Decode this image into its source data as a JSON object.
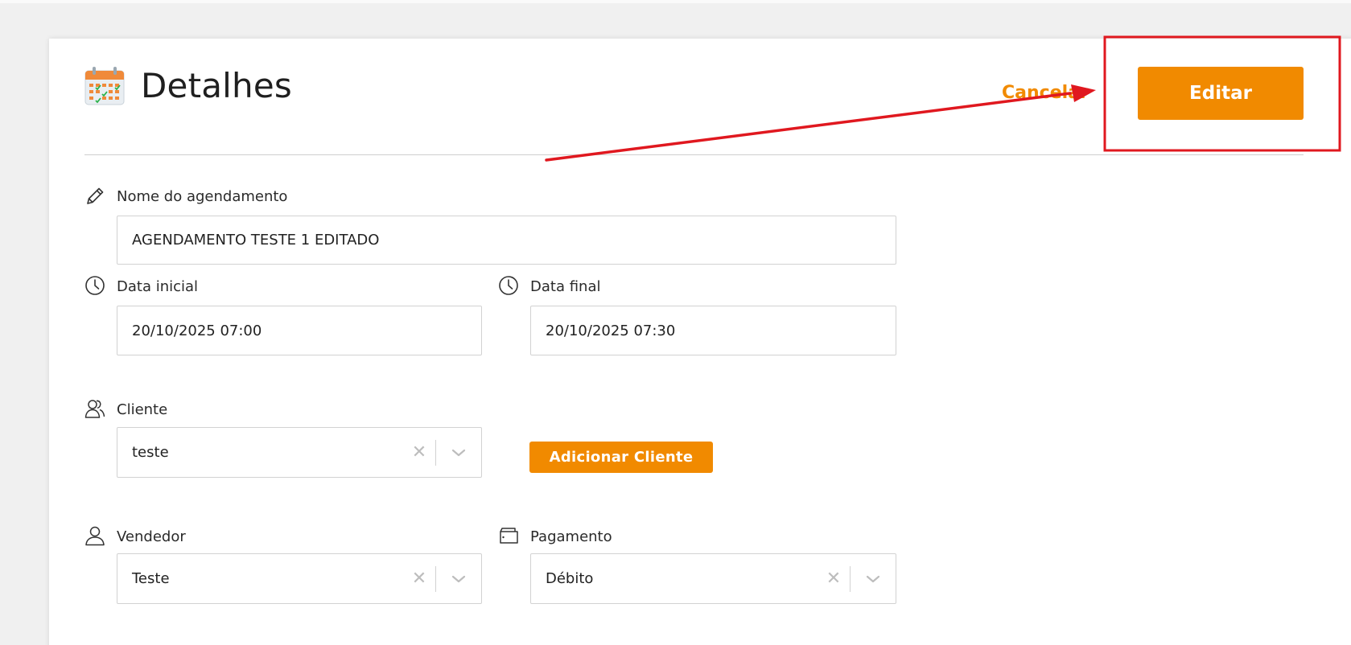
{
  "header": {
    "title": "Detalhes",
    "cancel_label": "Cancelar",
    "edit_label": "Editar"
  },
  "form": {
    "name": {
      "label": "Nome do agendamento",
      "value": "AGENDAMENTO TESTE 1 EDITADO"
    },
    "start_date": {
      "label": "Data inicial",
      "value": "20/10/2025 07:00"
    },
    "end_date": {
      "label": "Data final",
      "value": "20/10/2025 07:30"
    },
    "client": {
      "label": "Cliente",
      "value": "teste",
      "add_button": "Adicionar Cliente"
    },
    "seller": {
      "label": "Vendedor",
      "value": "Teste"
    },
    "payment": {
      "label": "Pagamento",
      "value": "Débito"
    }
  },
  "icons": {
    "header": "calendar-icon",
    "name": "pencil-icon",
    "start_date": "clock-icon",
    "end_date": "clock-icon",
    "client": "users-icon",
    "seller": "user-icon",
    "payment": "wallet-icon",
    "clear": "close-icon",
    "dropdown": "chevron-down-icon"
  },
  "colors": {
    "accent": "#f18a00",
    "annotation": "#e0181f"
  }
}
